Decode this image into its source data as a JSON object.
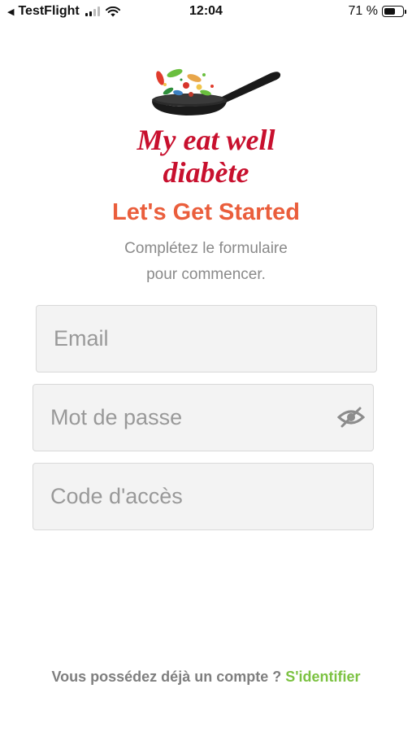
{
  "status_bar": {
    "back_arrow": "◀",
    "app": "TestFlight",
    "time": "12:04",
    "battery": "71 %",
    "battery_level": 0.71,
    "icons": [
      "signal-icon",
      "wifi-icon",
      "battery-icon"
    ]
  },
  "logo": {
    "line1": "My eat well",
    "line2": "diabète",
    "color": "#c8102e"
  },
  "title": "Let's Get Started",
  "subtitle_line1": "Complétez le formulaire",
  "subtitle_line2": "pour commencer.",
  "form": {
    "email_placeholder": "Email",
    "email_value": "",
    "password_placeholder": "Mot de passe",
    "password_value": "",
    "code_placeholder": "Code d'accès",
    "code_value": ""
  },
  "footer": {
    "text": "Vous possédez déjà un compte ? ",
    "link": "S'identifier",
    "link_color": "#7cc242"
  },
  "colors": {
    "accent": "#ea5e3c",
    "field_bg": "#f3f3f3",
    "muted_text": "#8a8a8a"
  }
}
